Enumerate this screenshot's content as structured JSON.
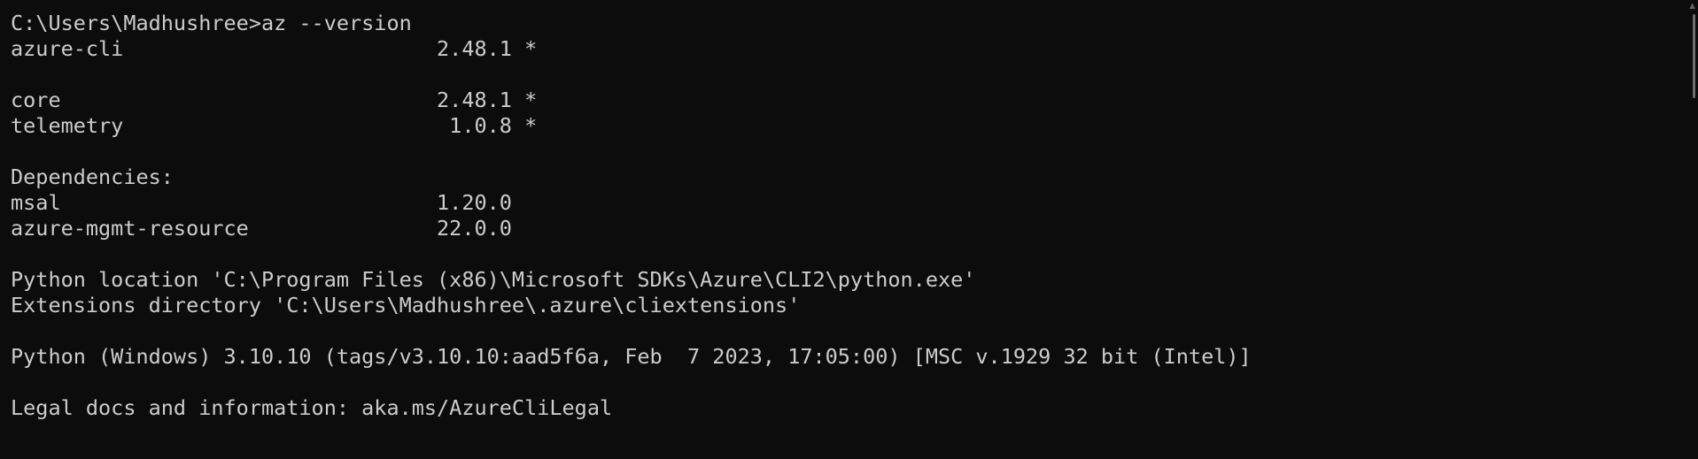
{
  "terminal": {
    "lines": [
      "C:\\Users\\Madhushree>az --version",
      "azure-cli                         2.48.1 *",
      "",
      "core                              2.48.1 *",
      "telemetry                          1.0.8 *",
      "",
      "Dependencies:",
      "msal                              1.20.0",
      "azure-mgmt-resource               22.0.0",
      "",
      "Python location 'C:\\Program Files (x86)\\Microsoft SDKs\\Azure\\CLI2\\python.exe'",
      "Extensions directory 'C:\\Users\\Madhushree\\.azure\\cliextensions'",
      "",
      "Python (Windows) 3.10.10 (tags/v3.10.10:aad5f6a, Feb  7 2023, 17:05:00) [MSC v.1929 32 bit (Intel)]",
      "",
      "Legal docs and information: aka.ms/AzureCliLegal"
    ],
    "scrollbar": {
      "up_icon": "▲"
    }
  },
  "colors": {
    "background": "#0c0c0c",
    "text": "#cccccc"
  }
}
